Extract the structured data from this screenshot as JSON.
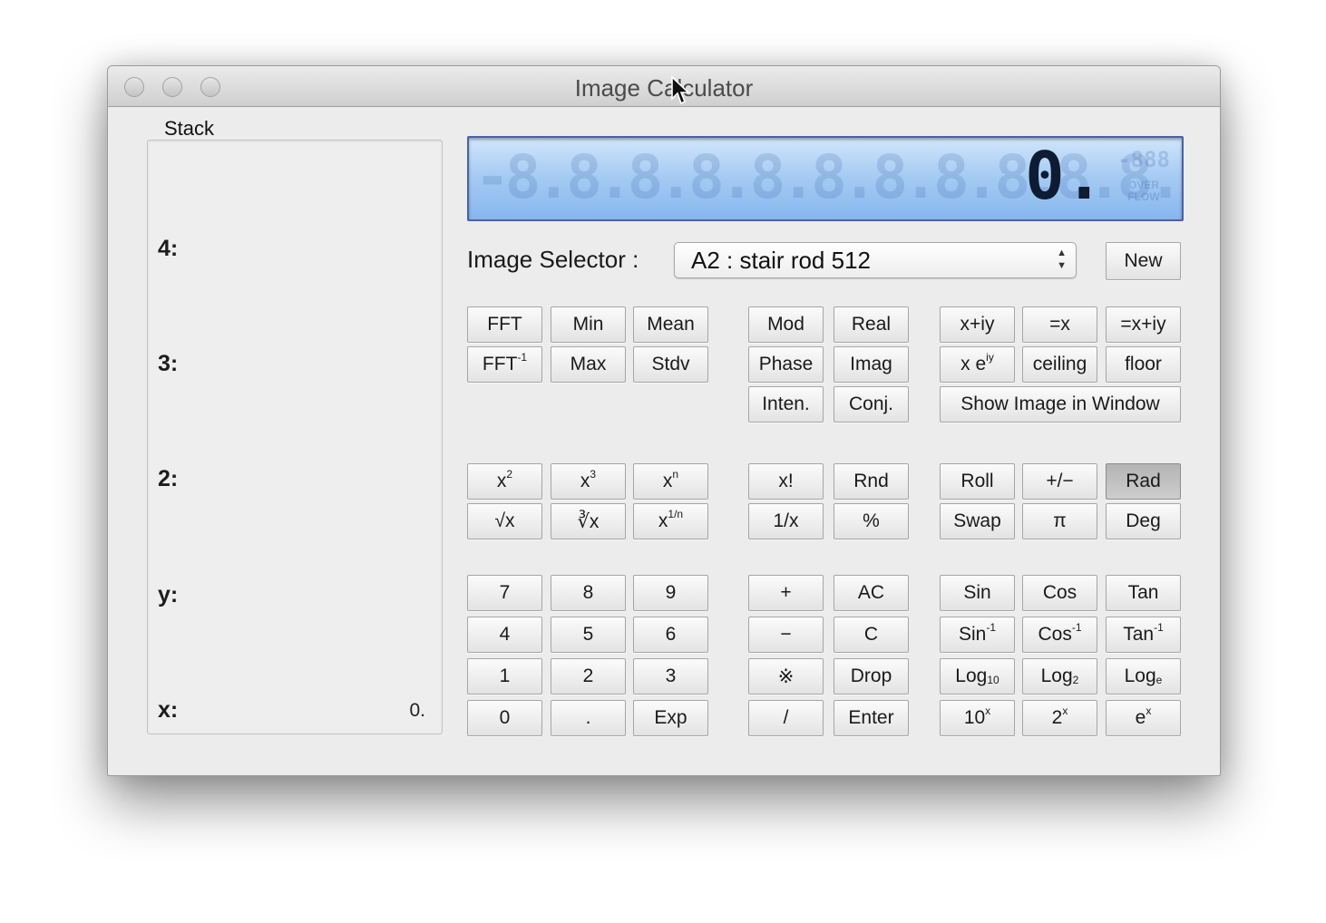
{
  "window": {
    "title": "Image Calculator"
  },
  "stack": {
    "label": "Stack",
    "registers": [
      {
        "label": "4:",
        "value": ""
      },
      {
        "label": "3:",
        "value": ""
      },
      {
        "label": "2:",
        "value": ""
      },
      {
        "label": "y:",
        "value": ""
      },
      {
        "label": "x:",
        "value": "0."
      }
    ]
  },
  "display": {
    "value": "0.",
    "overflow_indicator": "OVER FLOW"
  },
  "image_selector": {
    "label": "Image Selector :",
    "selected": "A2 : stair rod 512"
  },
  "new_button": {
    "label": "New"
  },
  "buttons": [
    {
      "id": "fft",
      "label": "FFT"
    },
    {
      "id": "fft-inv",
      "label": "FFT",
      "sup": "-1"
    },
    {
      "id": "min",
      "label": "Min"
    },
    {
      "id": "max",
      "label": "Max"
    },
    {
      "id": "mean",
      "label": "Mean"
    },
    {
      "id": "stdv",
      "label": "Stdv"
    },
    {
      "id": "mod",
      "label": "Mod"
    },
    {
      "id": "phase",
      "label": "Phase"
    },
    {
      "id": "inten",
      "label": "Inten."
    },
    {
      "id": "real",
      "label": "Real"
    },
    {
      "id": "imag",
      "label": "Imag"
    },
    {
      "id": "conj",
      "label": "Conj."
    },
    {
      "id": "x-plus-iy",
      "label": "x+iy"
    },
    {
      "id": "x-exp-iy",
      "label": "x e",
      "sup": "iy"
    },
    {
      "id": "eq-x",
      "label": "=x"
    },
    {
      "id": "ceiling",
      "label": "ceiling"
    },
    {
      "id": "eq-x-plus-iy",
      "label": "=x+iy"
    },
    {
      "id": "floor",
      "label": "floor"
    },
    {
      "id": "show-image",
      "label": "Show Image in Window"
    },
    {
      "id": "x-squared",
      "label": "x",
      "sup": "2"
    },
    {
      "id": "sqrt",
      "label": "√x"
    },
    {
      "id": "x-cubed",
      "label": "x",
      "sup": "3"
    },
    {
      "id": "cbrt",
      "label": "∛x"
    },
    {
      "id": "x-pow-n",
      "label": "x",
      "sup": "n"
    },
    {
      "id": "x-root-n",
      "label": "x",
      "sup": "1/n"
    },
    {
      "id": "factorial",
      "label": "x!"
    },
    {
      "id": "reciprocal",
      "label": "1/x"
    },
    {
      "id": "rnd",
      "label": "Rnd"
    },
    {
      "id": "percent",
      "label": "%"
    },
    {
      "id": "roll",
      "label": "Roll"
    },
    {
      "id": "swap",
      "label": "Swap"
    },
    {
      "id": "plus-minus",
      "label": "+/−"
    },
    {
      "id": "pi",
      "label": "π"
    },
    {
      "id": "rad",
      "label": "Rad",
      "pressed": true
    },
    {
      "id": "deg",
      "label": "Deg"
    },
    {
      "id": "digit-7",
      "label": "7"
    },
    {
      "id": "digit-8",
      "label": "8"
    },
    {
      "id": "digit-9",
      "label": "9"
    },
    {
      "id": "digit-4",
      "label": "4"
    },
    {
      "id": "digit-5",
      "label": "5"
    },
    {
      "id": "digit-6",
      "label": "6"
    },
    {
      "id": "digit-1",
      "label": "1"
    },
    {
      "id": "digit-2",
      "label": "2"
    },
    {
      "id": "digit-3",
      "label": "3"
    },
    {
      "id": "digit-0",
      "label": "0"
    },
    {
      "id": "decimal-point",
      "label": "."
    },
    {
      "id": "exp",
      "label": "Exp"
    },
    {
      "id": "add",
      "label": "+"
    },
    {
      "id": "subtract",
      "label": "−"
    },
    {
      "id": "multiply",
      "label": "※"
    },
    {
      "id": "divide",
      "label": "/"
    },
    {
      "id": "ac",
      "label": "AC"
    },
    {
      "id": "clear",
      "label": "C"
    },
    {
      "id": "drop",
      "label": "Drop"
    },
    {
      "id": "enter",
      "label": "Enter"
    },
    {
      "id": "sin",
      "label": "Sin"
    },
    {
      "id": "asin",
      "label": "Sin",
      "sup": "-1"
    },
    {
      "id": "log10",
      "label": "Log",
      "sub": "10"
    },
    {
      "id": "pow10",
      "label": "10",
      "sup": "x"
    },
    {
      "id": "cos",
      "label": "Cos"
    },
    {
      "id": "acos",
      "label": "Cos",
      "sup": "-1"
    },
    {
      "id": "log2",
      "label": "Log",
      "sub": "2"
    },
    {
      "id": "pow2",
      "label": "2",
      "sup": "x"
    },
    {
      "id": "tan",
      "label": "Tan"
    },
    {
      "id": "atan",
      "label": "Tan",
      "sup": "-1"
    },
    {
      "id": "loge",
      "label": "Log",
      "sub": "e"
    },
    {
      "id": "exp-e",
      "label": "e",
      "sup": "x"
    }
  ]
}
